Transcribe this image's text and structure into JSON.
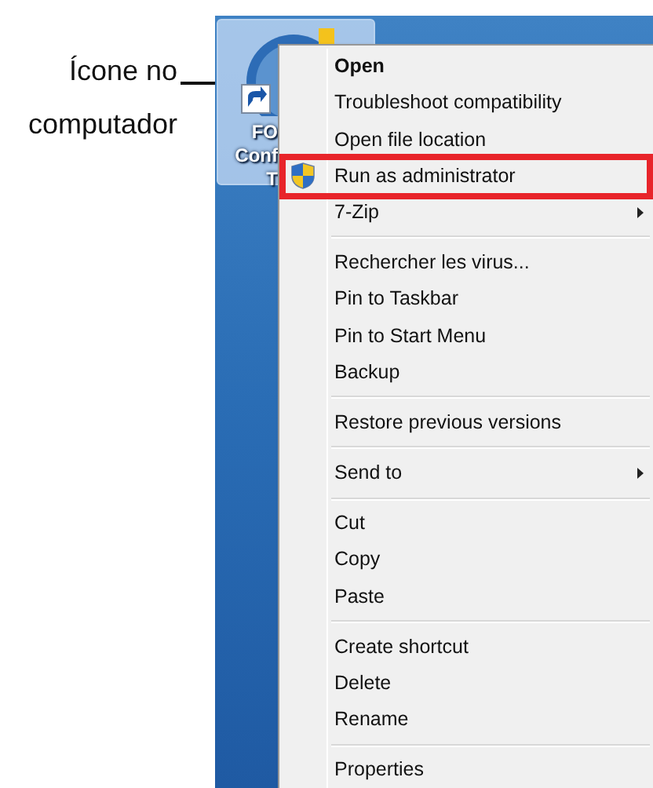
{
  "annotation": {
    "text": "Ícone no computador"
  },
  "desktop_icon": {
    "label_lines": [
      "FO",
      "Conf",
      "T"
    ],
    "selected": true
  },
  "context_menu": {
    "groups": [
      [
        {
          "label": "Open",
          "bold": true,
          "shield": false,
          "submenu": false,
          "highlighted": false
        },
        {
          "label": "Troubleshoot compatibility",
          "bold": false,
          "shield": false,
          "submenu": false,
          "highlighted": false
        },
        {
          "label": "Open file location",
          "bold": false,
          "shield": false,
          "submenu": false,
          "highlighted": false
        },
        {
          "label": "Run as administrator",
          "bold": false,
          "shield": true,
          "submenu": false,
          "highlighted": true
        },
        {
          "label": "7-Zip",
          "bold": false,
          "shield": false,
          "submenu": true,
          "highlighted": false
        }
      ],
      [
        {
          "label": "Rechercher les virus...",
          "bold": false,
          "shield": false,
          "submenu": false,
          "highlighted": false
        },
        {
          "label": "Pin to Taskbar",
          "bold": false,
          "shield": false,
          "submenu": false,
          "highlighted": false
        },
        {
          "label": "Pin to Start Menu",
          "bold": false,
          "shield": false,
          "submenu": false,
          "highlighted": false
        },
        {
          "label": "Backup",
          "bold": false,
          "shield": false,
          "submenu": false,
          "highlighted": false
        }
      ],
      [
        {
          "label": "Restore previous versions",
          "bold": false,
          "shield": false,
          "submenu": false,
          "highlighted": false
        }
      ],
      [
        {
          "label": "Send to",
          "bold": false,
          "shield": false,
          "submenu": true,
          "highlighted": false
        }
      ],
      [
        {
          "label": "Cut",
          "bold": false,
          "shield": false,
          "submenu": false,
          "highlighted": false
        },
        {
          "label": "Copy",
          "bold": false,
          "shield": false,
          "submenu": false,
          "highlighted": false
        },
        {
          "label": "Paste",
          "bold": false,
          "shield": false,
          "submenu": false,
          "highlighted": false
        }
      ],
      [
        {
          "label": "Create shortcut",
          "bold": false,
          "shield": false,
          "submenu": false,
          "highlighted": false
        },
        {
          "label": "Delete",
          "bold": false,
          "shield": false,
          "submenu": false,
          "highlighted": false
        },
        {
          "label": "Rename",
          "bold": false,
          "shield": false,
          "submenu": false,
          "highlighted": false
        }
      ],
      [
        {
          "label": "Properties",
          "bold": false,
          "shield": false,
          "submenu": false,
          "highlighted": false
        }
      ]
    ]
  }
}
